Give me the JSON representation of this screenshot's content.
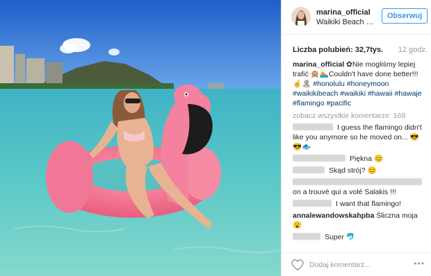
{
  "post": {
    "username": "marina_official",
    "location": "Waikiki Beach H...",
    "follow_label": "Obserwuj",
    "likes_label": "Liczba polubień: 32,7tys.",
    "time_ago": "12 godz."
  },
  "caption": {
    "username": "marina_official",
    "text_1": "✿Nie mogliśmy lepiej trafić 🙊🏊Couldn't have done better!!! ☝️🏝",
    "tags": "#honolulu #honeymoon #waikikibeach #waikiki #hawaii #hawaje #flamingo #pacific"
  },
  "more_comments_label": "zobacz wszystkie komentarze: 169",
  "comments": [
    {
      "text": "I guess the flamingo didn't like you anymore so he moved on... 😎😎🐟"
    },
    {
      "text": "Piękna 😊"
    },
    {
      "text": "Skąd strój? 😊"
    },
    {
      "text": "on a trouvé qui a volé Salakis !!!"
    },
    {
      "text": "I want that flamingo!"
    },
    {
      "username": "annalewandowskahpba",
      "text": "Śliczna moja 😮"
    },
    {
      "text": "Super 🐬"
    }
  ],
  "footer": {
    "add_comment_placeholder": "Dodaj komentarz...",
    "more_options": "•••"
  },
  "icons": {
    "like": "heart-icon",
    "more": "more-options-icon"
  },
  "colors": {
    "accent": "#3897f0",
    "hashtag": "#003569",
    "muted": "#999999"
  }
}
